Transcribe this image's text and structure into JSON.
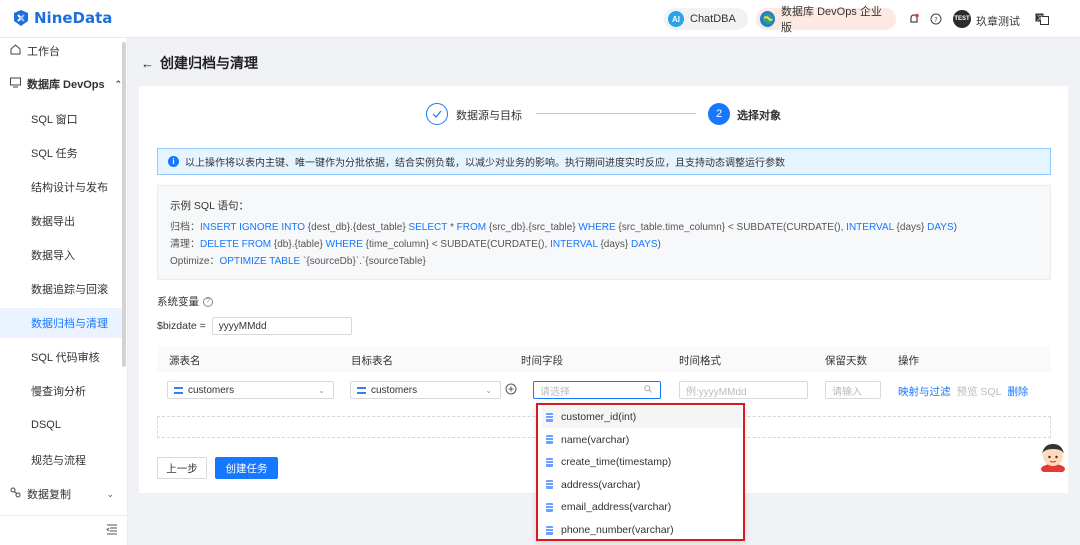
{
  "brand": {
    "name": "NineData"
  },
  "topbar": {
    "chatdba_label": "ChatDBA",
    "devops_label": "数据库 DevOps 企业版",
    "user_badge": "TEST",
    "user_name": "玖章测试"
  },
  "sidebar": {
    "workbench": "工作台",
    "devops_group": "数据库 DevOps",
    "items": [
      "SQL 窗口",
      "SQL 任务",
      "结构设计与发布",
      "数据导出",
      "数据导入",
      "数据追踪与回滚",
      "数据归档与清理",
      "SQL 代码审核",
      "慢查询分析",
      "DSQL",
      "规范与流程"
    ],
    "replication": "数据复制",
    "active_index": 6
  },
  "page": {
    "title": "创建归档与清理"
  },
  "steps": [
    {
      "number": "1",
      "label": "数据源与目标",
      "state": "done"
    },
    {
      "number": "2",
      "label": "选择对象",
      "state": "active"
    }
  ],
  "alert": {
    "text": "以上操作将以表内主键、唯一键作为分批依据，结合实例负载，以减少对业务的影响。执行期间进度实时反应，且支持动态调整运行参数"
  },
  "sql_example": {
    "title": "示例 SQL 语句：",
    "archive_prefix": "归档：",
    "archive": [
      {
        "t": "INSERT IGNORE INTO",
        "k": true
      },
      {
        "t": " {dest_db}.{dest_table} ",
        "k": false
      },
      {
        "t": "SELECT",
        "k": true
      },
      {
        "t": " * ",
        "k": false
      },
      {
        "t": "FROM",
        "k": true
      },
      {
        "t": " {src_db}.{src_table} ",
        "k": false
      },
      {
        "t": "WHERE",
        "k": true
      },
      {
        "t": " {src_table.time_column} < SUBDATE(CURDATE(), ",
        "k": false
      },
      {
        "t": "INTERVAL",
        "k": true
      },
      {
        "t": " {days} ",
        "k": false
      },
      {
        "t": "DAYS",
        "k": true
      },
      {
        "t": ")",
        "k": false
      }
    ],
    "clean_prefix": "清理：",
    "clean": [
      {
        "t": "DELETE FROM",
        "k": true
      },
      {
        "t": " {db}.{table} ",
        "k": false
      },
      {
        "t": "WHERE",
        "k": true
      },
      {
        "t": " {time_column} < SUBDATE(CURDATE(), ",
        "k": false
      },
      {
        "t": "INTERVAL",
        "k": true
      },
      {
        "t": " {days} ",
        "k": false
      },
      {
        "t": "DAYS",
        "k": true
      },
      {
        "t": ")",
        "k": false
      }
    ],
    "optimize_prefix": "Optimize：",
    "optimize": [
      {
        "t": "OPTIMIZE TABLE",
        "k": true
      },
      {
        "t": " `{sourceDb}`.`{sourceTable}",
        "k": false
      }
    ]
  },
  "vars": {
    "title": "系统变量",
    "name": "$bizdate =",
    "value": "yyyyMMdd"
  },
  "table": {
    "headers": [
      "源表名",
      "目标表名",
      "时间字段",
      "时间格式",
      "保留天数",
      "操作"
    ],
    "row": {
      "source": "customers",
      "target": "customers",
      "time_field_placeholder": "请选择",
      "time_format_placeholder": "例:yyyyMMdd",
      "days_placeholder": "请输入",
      "action_map": "映射与过滤",
      "action_preview": "预览 SQL",
      "action_delete": "删除"
    }
  },
  "buttons": {
    "prev": "上一步",
    "create": "创建任务"
  },
  "dropdown": {
    "options": [
      "customer_id(int)",
      "name(varchar)",
      "create_time(timestamp)",
      "address(varchar)",
      "email_address(varchar)",
      "phone_number(varchar)"
    ]
  },
  "colors": {
    "primary": "#1677ff",
    "highlight_border": "#d71920"
  }
}
